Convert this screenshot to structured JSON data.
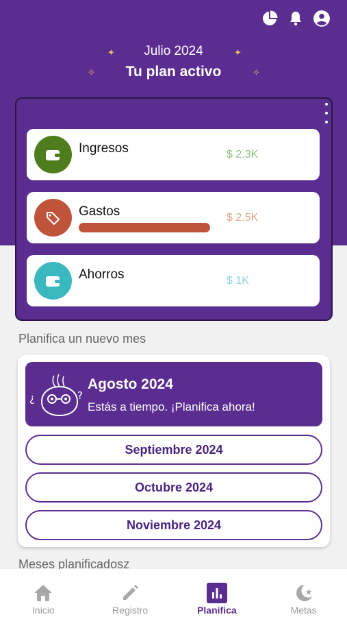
{
  "header": {
    "month": "Julio 2024",
    "plan_title": "Tu plan activo",
    "icons": [
      "pie-chart-icon",
      "bell-icon",
      "account-icon"
    ]
  },
  "plan": {
    "categories": [
      {
        "label": "Ingresos",
        "amount": "$ 2.3K",
        "icon": "wallet-icon",
        "color": "#4f7d1e",
        "amount_color": "#8cc07c"
      },
      {
        "label": "Gastos",
        "amount": "$ 2.5K",
        "icon": "tags-icon",
        "color": "#c0543a",
        "amount_color": "#e8a088",
        "progress": 1.0
      },
      {
        "label": "Ahorros",
        "amount": "$ 1K",
        "icon": "wallet-icon",
        "color": "#3ab8c0",
        "amount_color": "#8ad6e4"
      }
    ]
  },
  "new_month": {
    "section_label": "Planifica un nuevo mes",
    "featured": {
      "title": "Agosto 2024",
      "subtitle": "Estás a tiempo. ¡Planifica ahora!"
    },
    "months": [
      "Septiembre 2024",
      "Octubre 2024",
      "Noviembre 2024"
    ]
  },
  "planned": {
    "section_label": "Meses planificadosz"
  },
  "nav": {
    "items": [
      {
        "label": "Inicio",
        "icon": "home-icon"
      },
      {
        "label": "Registro",
        "icon": "pencil-icon"
      },
      {
        "label": "Planifica",
        "icon": "bar-chart-icon"
      },
      {
        "label": "Metas",
        "icon": "moon-star-icon"
      }
    ],
    "active": "Planifica"
  },
  "colors": {
    "brand": "#5c2d91",
    "background": "#f1f1f1",
    "sparkle": "#e7c35f"
  }
}
